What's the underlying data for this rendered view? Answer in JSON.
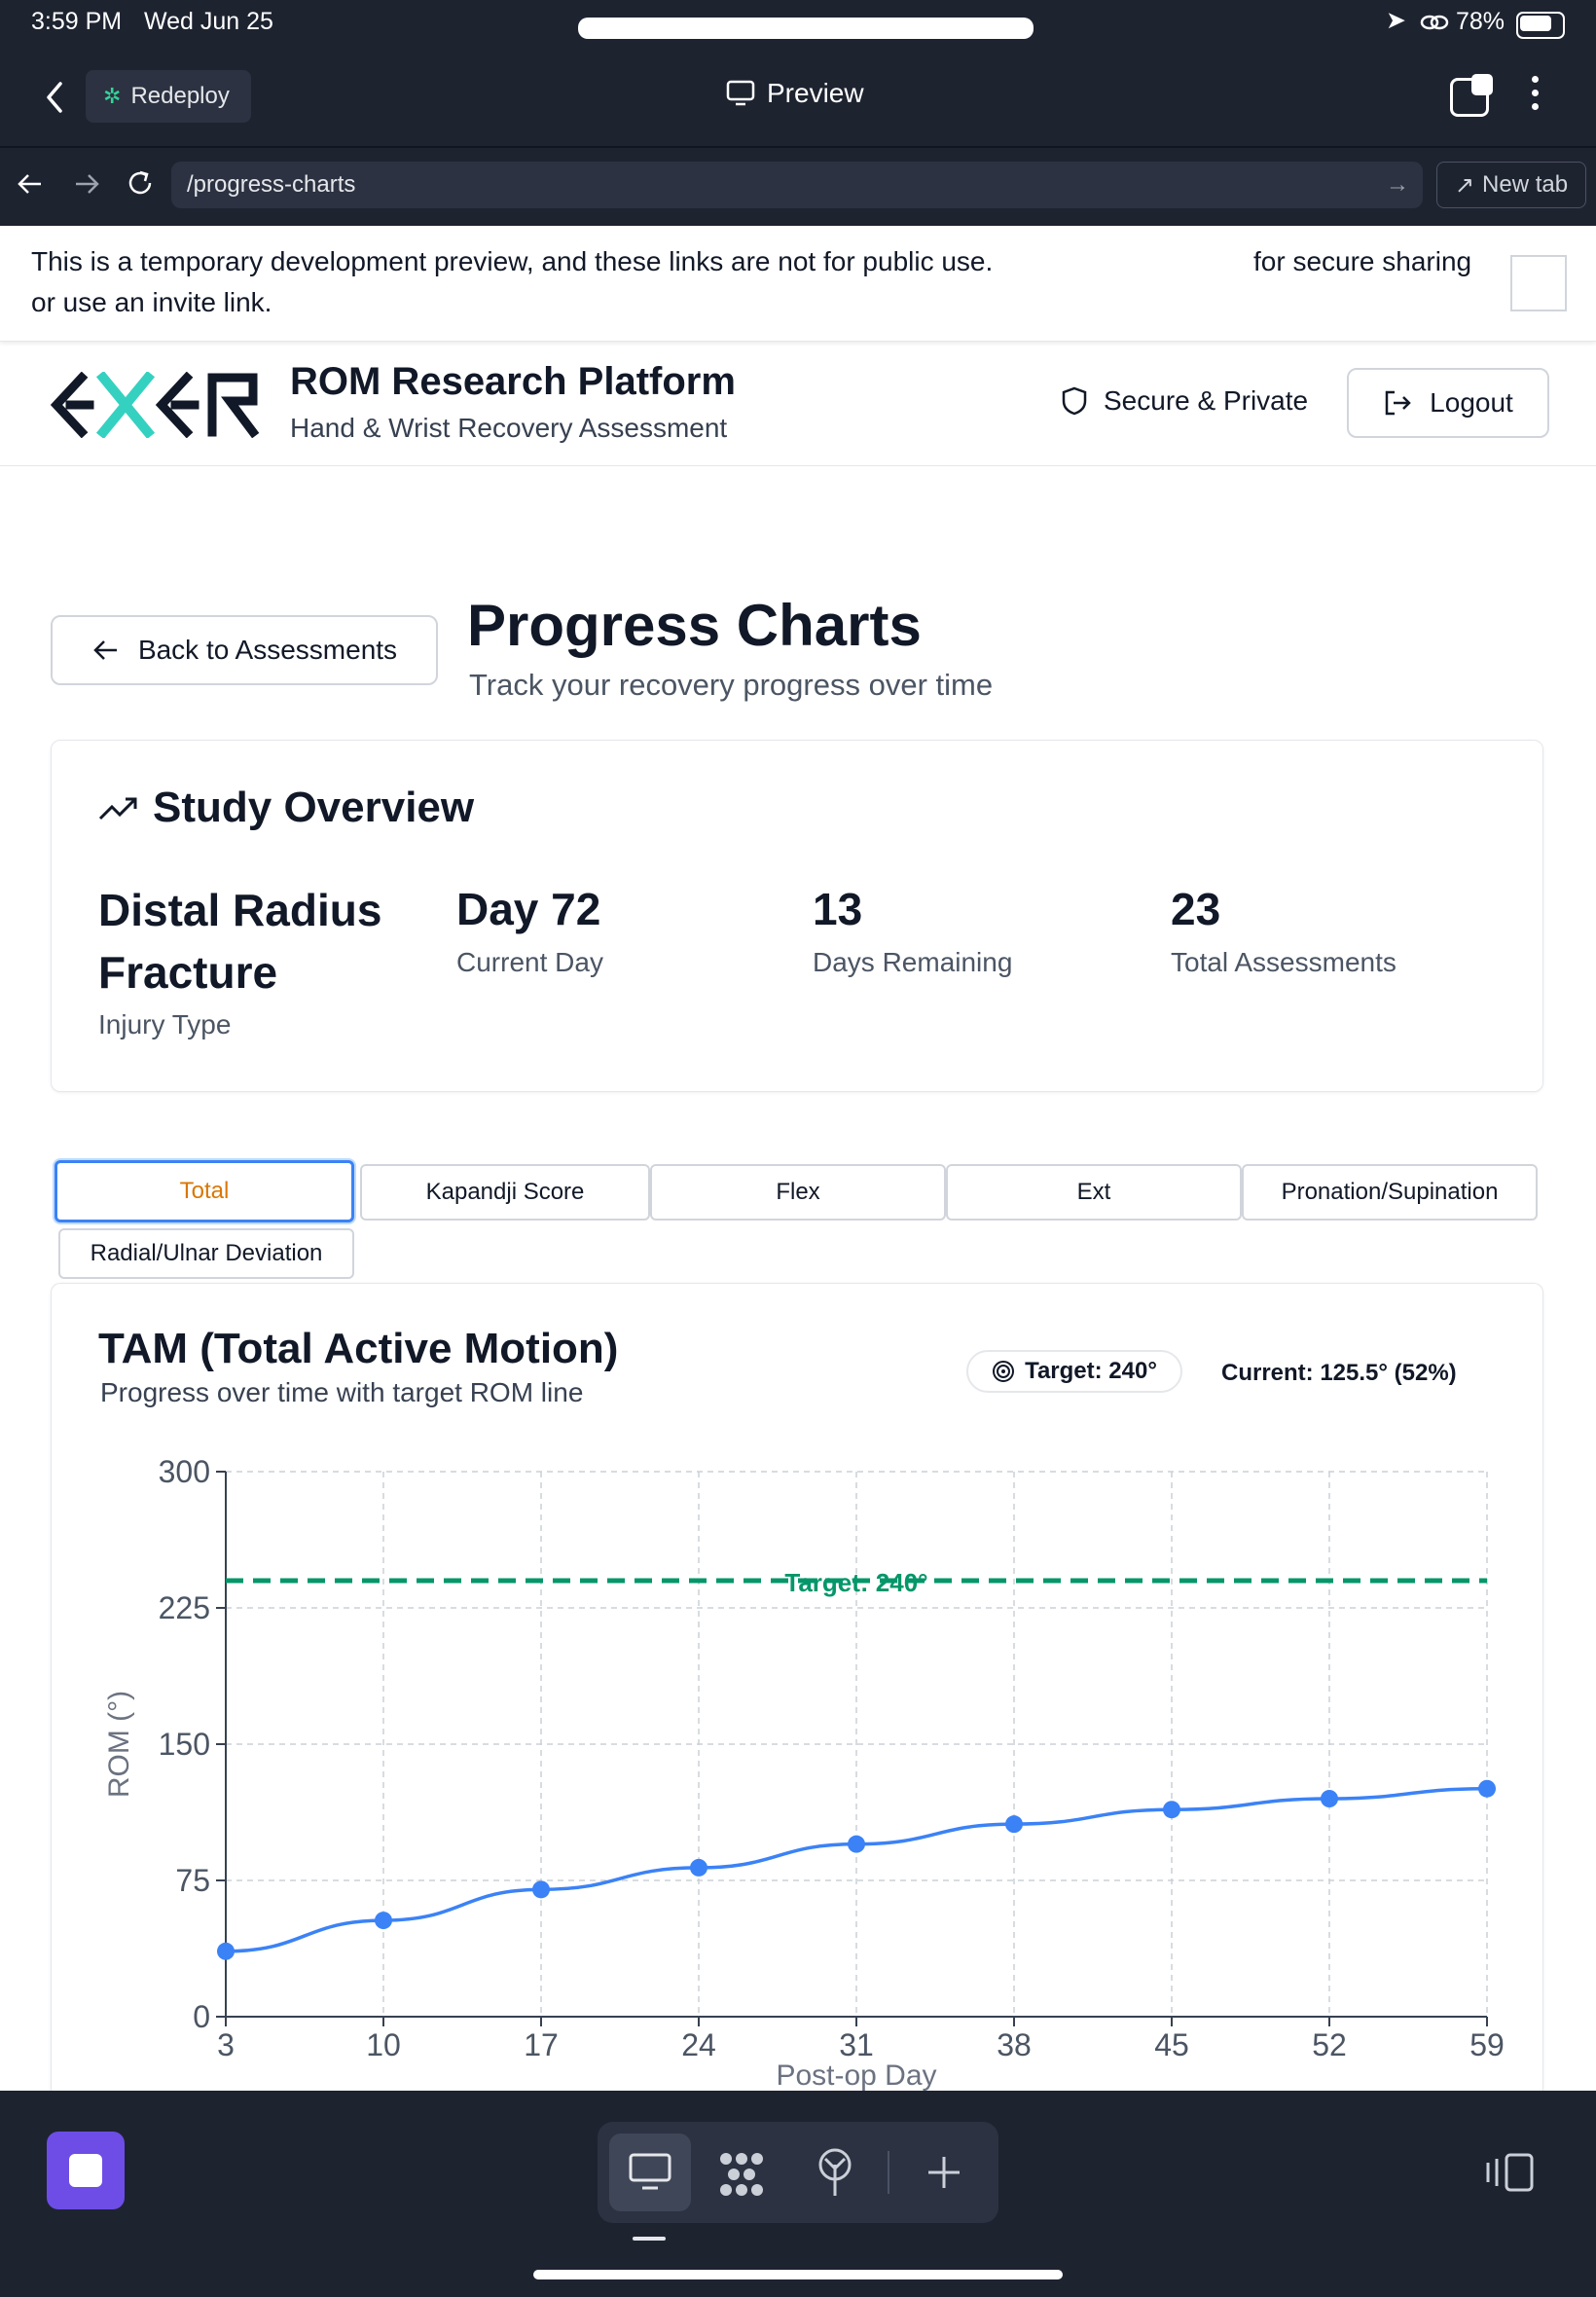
{
  "status_bar": {
    "time": "3:59 PM",
    "date": "Wed Jun 25",
    "battery": "78%"
  },
  "browser": {
    "redeploy_label": "Redeploy",
    "preview_label": "Preview",
    "url": "/progress-charts",
    "new_tab_label": "New tab"
  },
  "notice": {
    "line1": "This is a temporary development preview, and these links are not for public use.",
    "line2": "or use an invite link.",
    "right": "for secure sharing"
  },
  "header": {
    "title": "ROM Research Platform",
    "subtitle": "Hand & Wrist Recovery Assessment",
    "secure_label": "Secure & Private",
    "logout_label": "Logout"
  },
  "page": {
    "back_label": "Back to Assessments",
    "title": "Progress Charts",
    "subtitle": "Track your recovery progress over time"
  },
  "overview": {
    "title": "Study Overview",
    "stats": [
      {
        "value_line1": "Distal Radius",
        "value_line2": "Fracture",
        "label": "Injury Type"
      },
      {
        "value": "Day 72",
        "label": "Current Day"
      },
      {
        "value": "13",
        "label": "Days Remaining"
      },
      {
        "value": "23",
        "label": "Total Assessments"
      }
    ]
  },
  "tabs": [
    {
      "label": "Total",
      "active": true
    },
    {
      "label": "Kapandji Score",
      "active": false
    },
    {
      "label": "Flex",
      "active": false
    },
    {
      "label": "Ext",
      "active": false
    },
    {
      "label": "Pronation/Supination",
      "active": false
    },
    {
      "label": "Radial/Ulnar Deviation",
      "active": false
    }
  ],
  "chart_card": {
    "title": "TAM (Total Active Motion)",
    "subtitle": "Progress over time with target ROM line",
    "target_badge": "Target: 240°",
    "current": "Current: 125.5° (52%)"
  },
  "chart_data": {
    "type": "line",
    "xlabel": "Post-op Day",
    "ylabel": "ROM (°)",
    "x": [
      3,
      10,
      17,
      24,
      31,
      38,
      45,
      52,
      59
    ],
    "series": [
      {
        "values": [
          36,
          53,
          70,
          82,
          95,
          106,
          114,
          120,
          125.5
        ],
        "color": "#3b82f6"
      }
    ],
    "target": {
      "value": 240,
      "label": "Target: 240°",
      "color": "#059669"
    },
    "xlim": [
      3,
      59
    ],
    "ylim": [
      0,
      300
    ],
    "yticks": [
      0,
      75,
      150,
      225,
      300
    ],
    "grid": true
  },
  "colors": {
    "accent": "#3b82f6",
    "active_tab_text": "#d97706",
    "target": "#059669",
    "dock_app": "#6d4de6"
  }
}
